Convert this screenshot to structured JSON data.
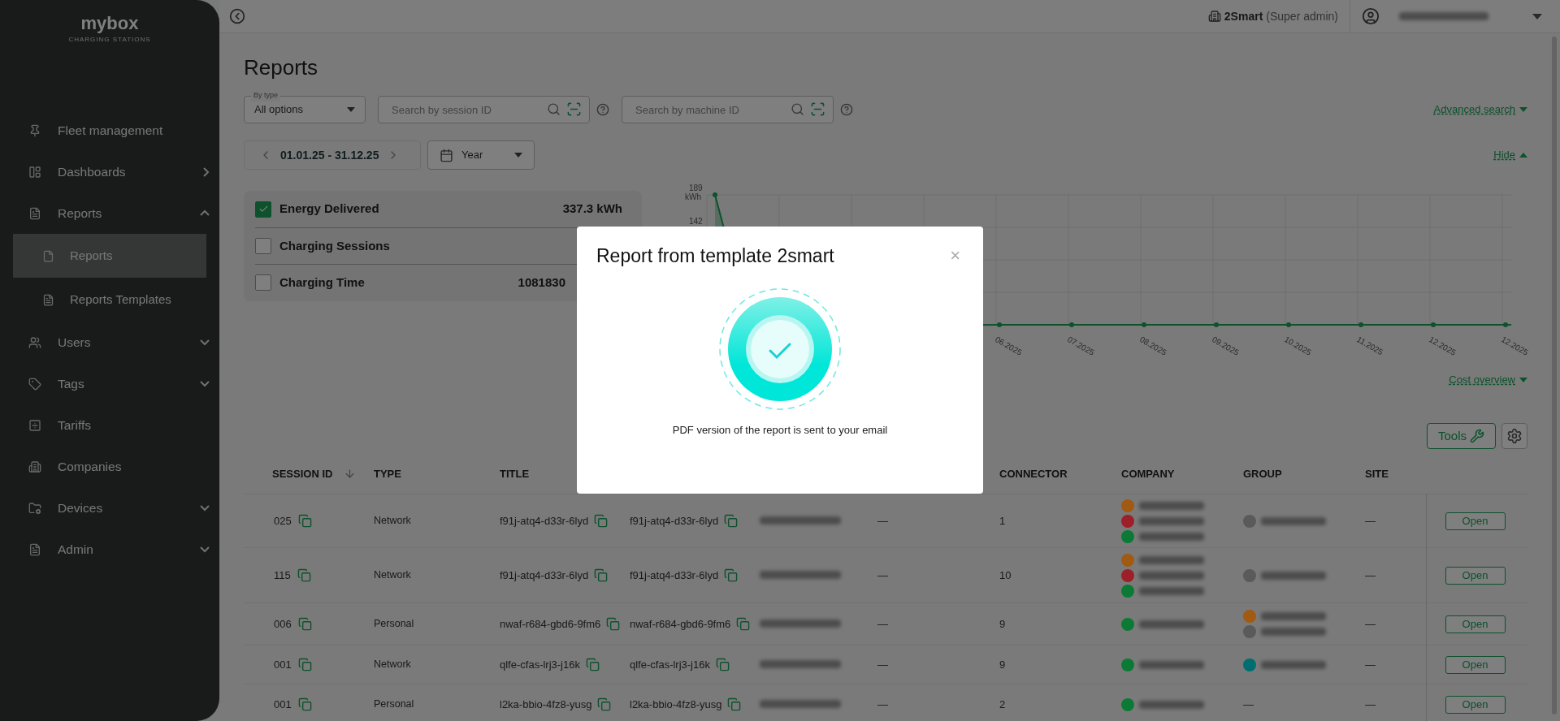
{
  "sidebar": {
    "logo": "mybox",
    "logo_tagline": "CHARGING STATIONS",
    "items": [
      {
        "label": "Fleet management",
        "kind": "link"
      },
      {
        "label": "Dashboards",
        "kind": "flyout"
      },
      {
        "label": "Reports",
        "kind": "group",
        "expanded": true,
        "children": [
          {
            "label": "Reports",
            "selected": true
          },
          {
            "label": "Reports Templates",
            "selected": false
          }
        ]
      },
      {
        "label": "Users",
        "kind": "group",
        "expanded": false
      },
      {
        "label": "Tags",
        "kind": "group",
        "expanded": false
      },
      {
        "label": "Tariffs",
        "kind": "link"
      },
      {
        "label": "Companies",
        "kind": "link"
      },
      {
        "label": "Devices",
        "kind": "group",
        "expanded": false
      },
      {
        "label": "Admin",
        "kind": "group",
        "expanded": false
      }
    ]
  },
  "topbar": {
    "company": "2Smart",
    "role": "(Super admin)"
  },
  "page": {
    "title": "Reports",
    "type_filter": {
      "label": "By type",
      "value": "All options"
    },
    "session_search": {
      "placeholder": "Search by session ID"
    },
    "machine_search": {
      "placeholder": "Search by machine ID"
    },
    "advanced_search": "Advanced search",
    "date_range": "01.01.25 - 31.12.25",
    "period": "Year",
    "hide_link": "Hide",
    "metrics": [
      {
        "label": "Energy Delivered",
        "checked": true,
        "value": "337.3 kWh"
      },
      {
        "label": "Charging Sessions",
        "checked": false
      },
      {
        "label": "Charging Time",
        "checked": false,
        "value": "1081830"
      }
    ],
    "chart": {
      "y_labels": [
        "189",
        "kWh",
        "142"
      ],
      "x_labels": [
        "06.2025",
        "07.2025",
        "08.2025",
        "09.2025",
        "10.2025",
        "11.2025",
        "12.2025",
        "12.2025"
      ]
    },
    "cost_overview": "Cost overview",
    "tools_button": "Tools"
  },
  "table": {
    "columns": [
      "SESSION ID",
      "TYPE",
      "TITLE",
      "CONNECTOR",
      "COMPANY",
      "GROUP",
      "SITE"
    ],
    "rows": [
      {
        "session_id": "025",
        "type": "Network",
        "title": "f91j-atq4-d33r-6lyd",
        "column_4": "f91j-atq4-d33r-6lyd",
        "column_6": "—",
        "connector": "1",
        "companies": [
          {
            "color": "#a05a12"
          },
          {
            "color": "#9c1f2a"
          },
          {
            "color": "#0a7a35"
          }
        ],
        "groups": [
          {
            "color": "#5a5a5a"
          }
        ],
        "site": "—",
        "action": "Open"
      },
      {
        "session_id": "115",
        "type": "Network",
        "title": "f91j-atq4-d33r-6lyd",
        "column_4": "f91j-atq4-d33r-6lyd",
        "column_6": "—",
        "connector": "10",
        "companies": [
          {
            "color": "#a05a12"
          },
          {
            "color": "#9c1f2a"
          },
          {
            "color": "#0a7a35"
          }
        ],
        "groups": [
          {
            "color": "#5a5a5a"
          }
        ],
        "site": "—",
        "action": "Open"
      },
      {
        "session_id": "006",
        "type": "Personal",
        "title": "nwaf-r684-gbd6-9fm6",
        "column_4": "nwaf-r684-gbd6-9fm6",
        "column_6": "—",
        "connector": "9",
        "companies": [
          {
            "color": "#0a7a35"
          }
        ],
        "groups": [
          {
            "color": "#a05a12"
          },
          {
            "color": "#5a5a5a"
          }
        ],
        "site": "—",
        "action": "Open"
      },
      {
        "session_id": "001",
        "type": "Network",
        "title": "qlfe-cfas-lrj3-j16k",
        "column_4": "qlfe-cfas-lrj3-j16k",
        "column_6": "—",
        "connector": "9",
        "companies": [
          {
            "color": "#0a7a35"
          }
        ],
        "groups": [
          {
            "color": "#006e70"
          }
        ],
        "site": "—",
        "action": "Open"
      },
      {
        "session_id": "001",
        "type": "Personal",
        "title": "l2ka-bbio-4fz8-yusg",
        "column_4": "l2ka-bbio-4fz8-yusg",
        "column_6": "—",
        "connector": "2",
        "companies": [
          {
            "color": "#0a7a35"
          }
        ],
        "group_text": "—",
        "site": "—",
        "action": "Open"
      }
    ]
  },
  "modal": {
    "title": "Report from template 2smart",
    "close": "×",
    "message": "PDF version of the report is sent to your email"
  }
}
